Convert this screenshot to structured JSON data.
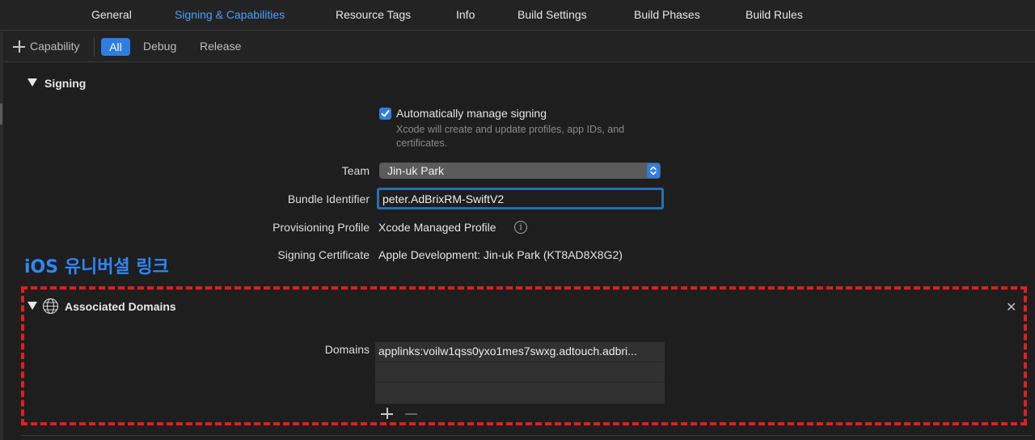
{
  "tabs": [
    {
      "label": "General",
      "active": false
    },
    {
      "label": "Signing & Capabilities",
      "active": true
    },
    {
      "label": "Resource Tags",
      "active": false
    },
    {
      "label": "Info",
      "active": false
    },
    {
      "label": "Build Settings",
      "active": false
    },
    {
      "label": "Build Phases",
      "active": false
    },
    {
      "label": "Build Rules",
      "active": false
    }
  ],
  "filter": {
    "capability_label": "Capability",
    "options": [
      "All",
      "Debug",
      "Release"
    ],
    "selected": "All"
  },
  "signing": {
    "title": "Signing",
    "auto_manage_label": "Automatically manage signing",
    "auto_manage_checked": true,
    "auto_manage_hint": "Xcode will create and update profiles, app IDs, and certificates.",
    "team_label": "Team",
    "team_value": "Jin-uk Park",
    "bundle_label": "Bundle Identifier",
    "bundle_value": "peter.AdBrixRM-SwiftV2",
    "profile_label": "Provisioning Profile",
    "profile_value": "Xcode Managed Profile",
    "cert_label": "Signing Certificate",
    "cert_value": "Apple Development: Jin-uk Park (KT8AD8X8G2)"
  },
  "annotation": "iOS 유니버셜 링크",
  "associated_domains": {
    "title": "Associated Domains",
    "domains_label": "Domains",
    "domains": [
      "applinks:voilw1qss0yxo1mes7swxg.adtouch.adbri..."
    ]
  },
  "colors": {
    "accent": "#2f7de1",
    "annotation_text": "#2f86f3",
    "highlight_box": "#e01e1e"
  }
}
